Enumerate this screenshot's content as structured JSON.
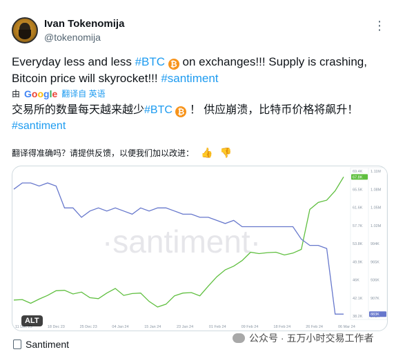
{
  "author": {
    "name": "Ivan Tokenomija",
    "handle": "@tokenomija"
  },
  "tweet": {
    "line1_part1": "Everyday less and less ",
    "hashtag_btc": "#BTC",
    "btc_icon": "₿",
    "line1_part2": " on exchanges!!! Supply is crashing,",
    "line2_part1": "Bitcoin price will skyrocket!!! ",
    "hashtag_santiment": "#santiment"
  },
  "translation_bar": {
    "prefix": "由",
    "provider": {
      "G": "G",
      "o1": "o",
      "o2": "o",
      "g": "g",
      "l": "l",
      "e": "e"
    },
    "link": "翻译自 英语"
  },
  "translated": {
    "part1": "交易所的数量每天越来越少",
    "hashtag_btc": "#BTC",
    "part2": " ！ 供应崩溃，比特币价格将飙升！",
    "hashtag_santiment": "#santiment"
  },
  "feedback": {
    "question": "翻译得准确吗？请提供反馈，以便我们加以改进：",
    "thumbs_up": "👍",
    "thumbs_down": "👎"
  },
  "media": {
    "alt_label": "ALT",
    "watermark": "·santiment·"
  },
  "chart_data": {
    "type": "line",
    "x_ticks": [
      "11 Dec 23",
      "18 Dec 23",
      "25 Dec 23",
      "04 Jan 24",
      "15 Jan 24",
      "23 Jan 24",
      "01 Feb 24",
      "09 Feb 24",
      "18 Feb 24",
      "26 Feb 24",
      "06 Mar 24"
    ],
    "left_axis_ticks": [
      "69.4K",
      "65.5K",
      "61.6K",
      "57.7K",
      "53.8K",
      "49.9K",
      "46K",
      "42.1K",
      "38.2K"
    ],
    "right_axis_ticks": [
      "1.11M",
      "1.08M",
      "1.05M",
      "1.02M",
      "994K",
      "965K",
      "936K",
      "907K",
      "878K"
    ],
    "left_axis_badge": "67.8K",
    "right_axis_badge": "883K",
    "series": [
      {
        "color": "#5fbf3f",
        "values": [
          41.5,
          41.6,
          40.8,
          41.7,
          42.5,
          43.5,
          43.6,
          42.8,
          43.2,
          42.0,
          41.8,
          43.0,
          44.0,
          42.5,
          42.9,
          43.0,
          41.2,
          40.0,
          40.6,
          42.4,
          43.0,
          43.1,
          42.4,
          44.5,
          46.5,
          48.0,
          48.8,
          50.0,
          51.8,
          51.5,
          51.7,
          51.8,
          51.2,
          51.6,
          52.4,
          61.0,
          62.5,
          63.0,
          65.0,
          68.0
        ]
      },
      {
        "color": "#6677cc",
        "values": [
          1.08,
          1.09,
          1.09,
          1.085,
          1.09,
          1.085,
          1.05,
          1.05,
          1.035,
          1.045,
          1.05,
          1.045,
          1.05,
          1.045,
          1.04,
          1.05,
          1.045,
          1.05,
          1.05,
          1.045,
          1.04,
          1.04,
          1.035,
          1.035,
          1.03,
          1.025,
          1.03,
          1.02,
          1.02,
          1.02,
          1.02,
          1.02,
          1.02,
          1.02,
          1.0,
          0.99,
          0.99,
          0.985,
          0.88,
          0.88
        ]
      }
    ]
  },
  "source": {
    "label": "Santiment"
  },
  "page_watermark": {
    "text": "公众号 · 五万小时交易工作者"
  }
}
